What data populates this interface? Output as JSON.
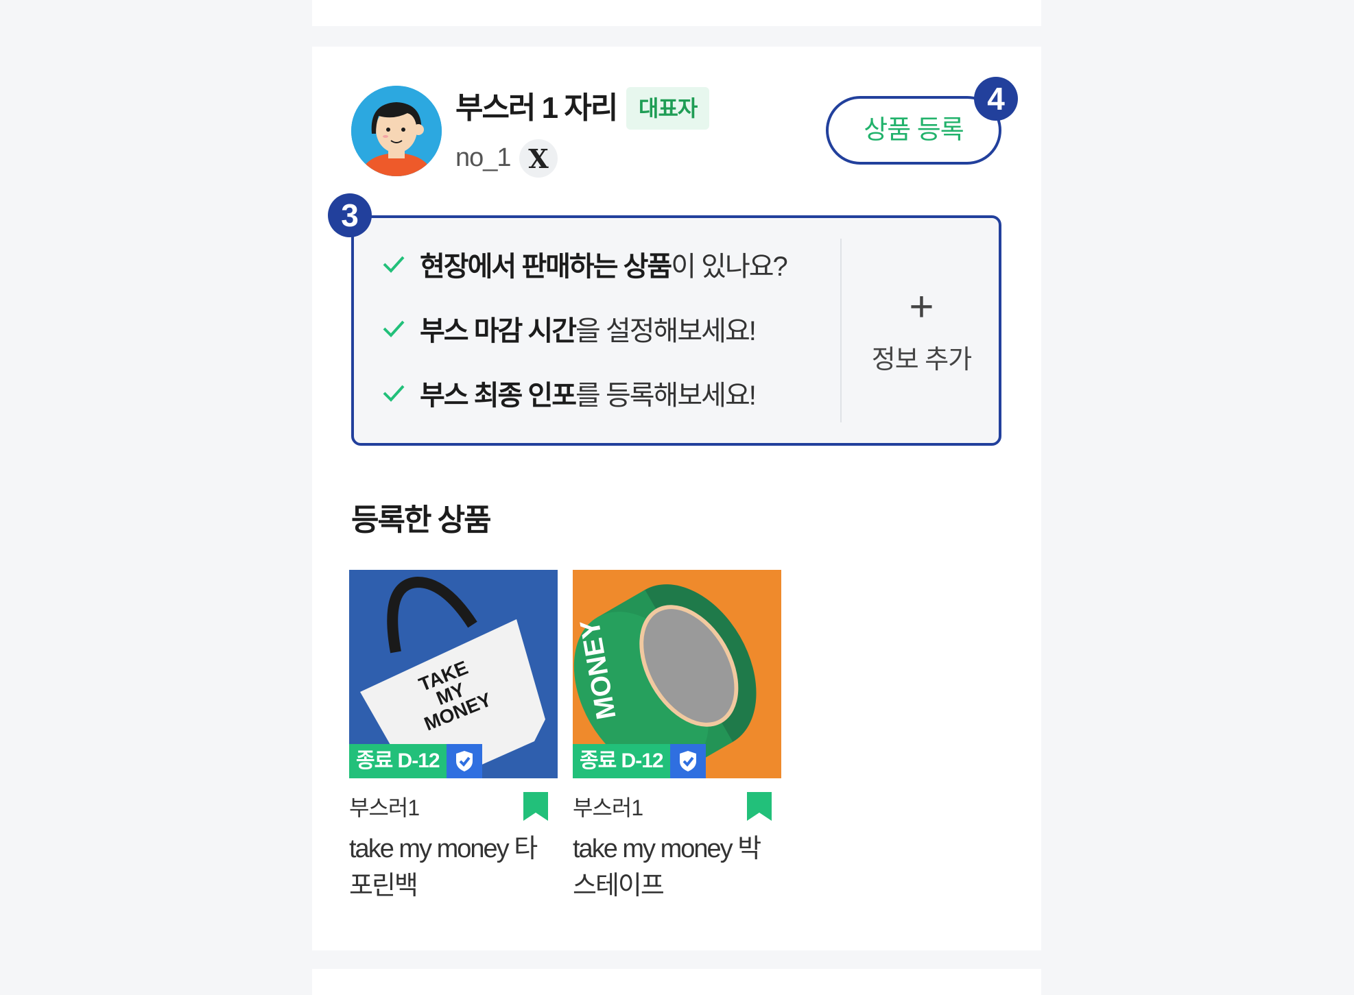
{
  "profile": {
    "booth_name": "부스러 1 자리",
    "rep_badge": "대표자",
    "handle": "no_1",
    "social_icon": "X"
  },
  "register_button": {
    "label": "상품 등록"
  },
  "step_badges": {
    "info": "3",
    "register": "4"
  },
  "info_box": {
    "items": [
      {
        "bold": "현장에서 판매하는 상품",
        "rest": "이 있나요?"
      },
      {
        "bold": "부스 마감 시간",
        "rest": "을 설정해보세요!"
      },
      {
        "bold": "부스 최종 인포",
        "rest": "를 등록해보세요!"
      }
    ],
    "add_label": "정보 추가",
    "add_icon": "+"
  },
  "section_title": "등록한 상품",
  "products": [
    {
      "deadline": "종료 D-12",
      "seller": "부스러1",
      "title": "take my money 타포린백",
      "image_text": [
        "TAKE",
        "MY",
        "MONEY"
      ],
      "image_bg": "#2f5fae"
    },
    {
      "deadline": "종료 D-12",
      "seller": "부스러1",
      "title": "take my money 박스테이프",
      "image_text": [
        "MONEY"
      ],
      "image_bg": "#ef8a2c"
    }
  ],
  "colors": {
    "accent_blue": "#22409c",
    "accent_green": "#22c07a",
    "shield_blue": "#2f6fe0"
  }
}
